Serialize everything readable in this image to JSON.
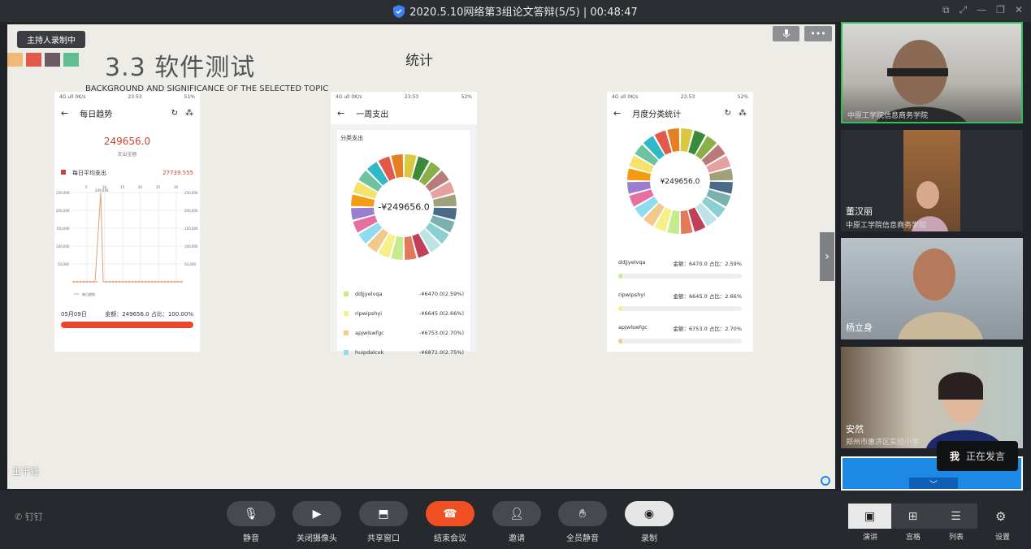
{
  "window": {
    "title": "2020.5.10网络第3组论文答辩(5/5) | 00:48:47"
  },
  "stage": {
    "rec_badge": "主持人录制中",
    "slide_title": "3.3 软件测试",
    "slide_subtitle": "BACKGROUND AND SIGNIFICANCE OF THE SELECTED TOPIC",
    "slide_heading": "统计",
    "presenter": "王千钰",
    "swatch_colors": [
      "#f0b978",
      "#e2584a",
      "#6b5a63",
      "#5fbf94"
    ]
  },
  "phone1": {
    "status_left": "4G ull 0K/s",
    "status_time": "23:53",
    "status_right": "51%",
    "title": "每日趋势",
    "total": "249656.0",
    "total_label": "支出金额",
    "avg_label": "每日平均支出",
    "avg_value": "27739.555",
    "date": "05月09日",
    "summary": "金额：249656.0 占比：100.00%"
  },
  "phone2": {
    "status_left": "4G ull 0K/s",
    "status_time": "23:53",
    "status_right": "52%",
    "title": "一周支出",
    "card_title": "分类支出",
    "center": "-¥249656.0",
    "legend": [
      {
        "name": "ddjjyelvqa",
        "value": "-¥6470.0(2.59%)",
        "color": "#c6ea8e"
      },
      {
        "name": "ripwipshyi",
        "value": "-¥6645.0(2.66%)",
        "color": "#f6f08a"
      },
      {
        "name": "apjwlswfgc",
        "value": "-¥6753.0(2.70%)",
        "color": "#f3c98b"
      },
      {
        "name": "huipdalcxk",
        "value": "-¥6871.0(2.75%)",
        "color": "#8fdcf0"
      }
    ]
  },
  "phone3": {
    "status_left": "4G ull 0K/s",
    "status_time": "23:53",
    "status_right": "52%",
    "title": "月度分类统计",
    "center": "¥249656.0",
    "rows": [
      {
        "name": "ddjjyelvqa",
        "value": "金额：6470.0 占比：2.59%",
        "pct": 2.59,
        "color": "#c6ea8e"
      },
      {
        "name": "ripwipshyi",
        "value": "金额：6645.0 占比：2.66%",
        "pct": 2.66,
        "color": "#f6f08a"
      },
      {
        "name": "apjwlswfgc",
        "value": "金额：6753.0 占比：2.70%",
        "pct": 2.7,
        "color": "#f3c98b"
      }
    ]
  },
  "participants": [
    {
      "name": "",
      "org": "中原工学院信息商务学院"
    },
    {
      "name": "董汉丽",
      "org": "中原工学院信息商务学院"
    },
    {
      "name": "杨立身",
      "org": ""
    },
    {
      "name": "安然",
      "org": "郑州市惠济区实验小学"
    }
  ],
  "speaking": {
    "who": "我",
    "status": "正在发言"
  },
  "toolbar": {
    "mute": "静音",
    "camera": "关闭摄像头",
    "share": "共享窗口",
    "end": "结束会议",
    "invite": "邀请",
    "mute_all": "全员静音",
    "record": "录制",
    "brand": "钉钉",
    "view_speaker": "演讲",
    "view_grid": "宫格",
    "view_list": "列表",
    "settings": "设置"
  }
}
